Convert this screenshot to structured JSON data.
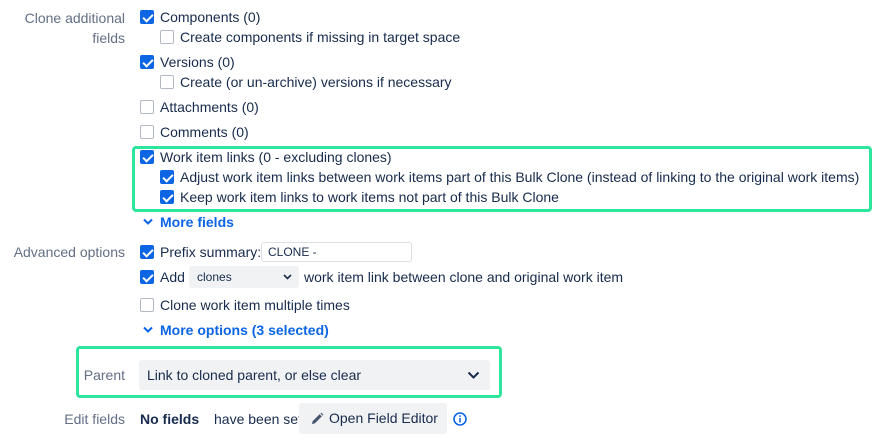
{
  "sections": {
    "clone_fields_label_line1": "Clone additional",
    "clone_fields_label_line2": "fields",
    "advanced_options_label": "Advanced options",
    "parent_label": "Parent",
    "edit_fields_label": "Edit fields"
  },
  "clone_fields": {
    "components": "Components (0)",
    "create_components": "Create components if missing in target space",
    "versions": "Versions (0)",
    "create_versions": "Create (or un-archive) versions if necessary",
    "attachments": "Attachments (0)",
    "comments": "Comments (0)",
    "work_item_links": "Work item links (0 - excluding clones)",
    "adjust_links": "Adjust work item links between work items part of this Bulk Clone (instead of linking to the original work items)",
    "keep_links": "Keep work item links to work items not part of this Bulk Clone",
    "more_fields": "More fields"
  },
  "advanced": {
    "prefix_summary_label": "Prefix summary:",
    "prefix_summary_value": "CLONE -",
    "add_label": "Add",
    "link_type_value": "clones",
    "link_suffix": "work item link between clone and original work item",
    "clone_multiple": "Clone work item multiple times",
    "more_options": "More options (3 selected)"
  },
  "parent": {
    "value": "Link to cloned parent, or else clear"
  },
  "edit_fields": {
    "no_fields_bold": "No fields",
    "no_fields_rest": "have been set",
    "open_editor_button": "Open Field Editor"
  },
  "colors": {
    "checkbox_on": "#0c66e4",
    "link": "#0c66e4",
    "highlight": "#2ee59d",
    "label": "#626f86"
  }
}
